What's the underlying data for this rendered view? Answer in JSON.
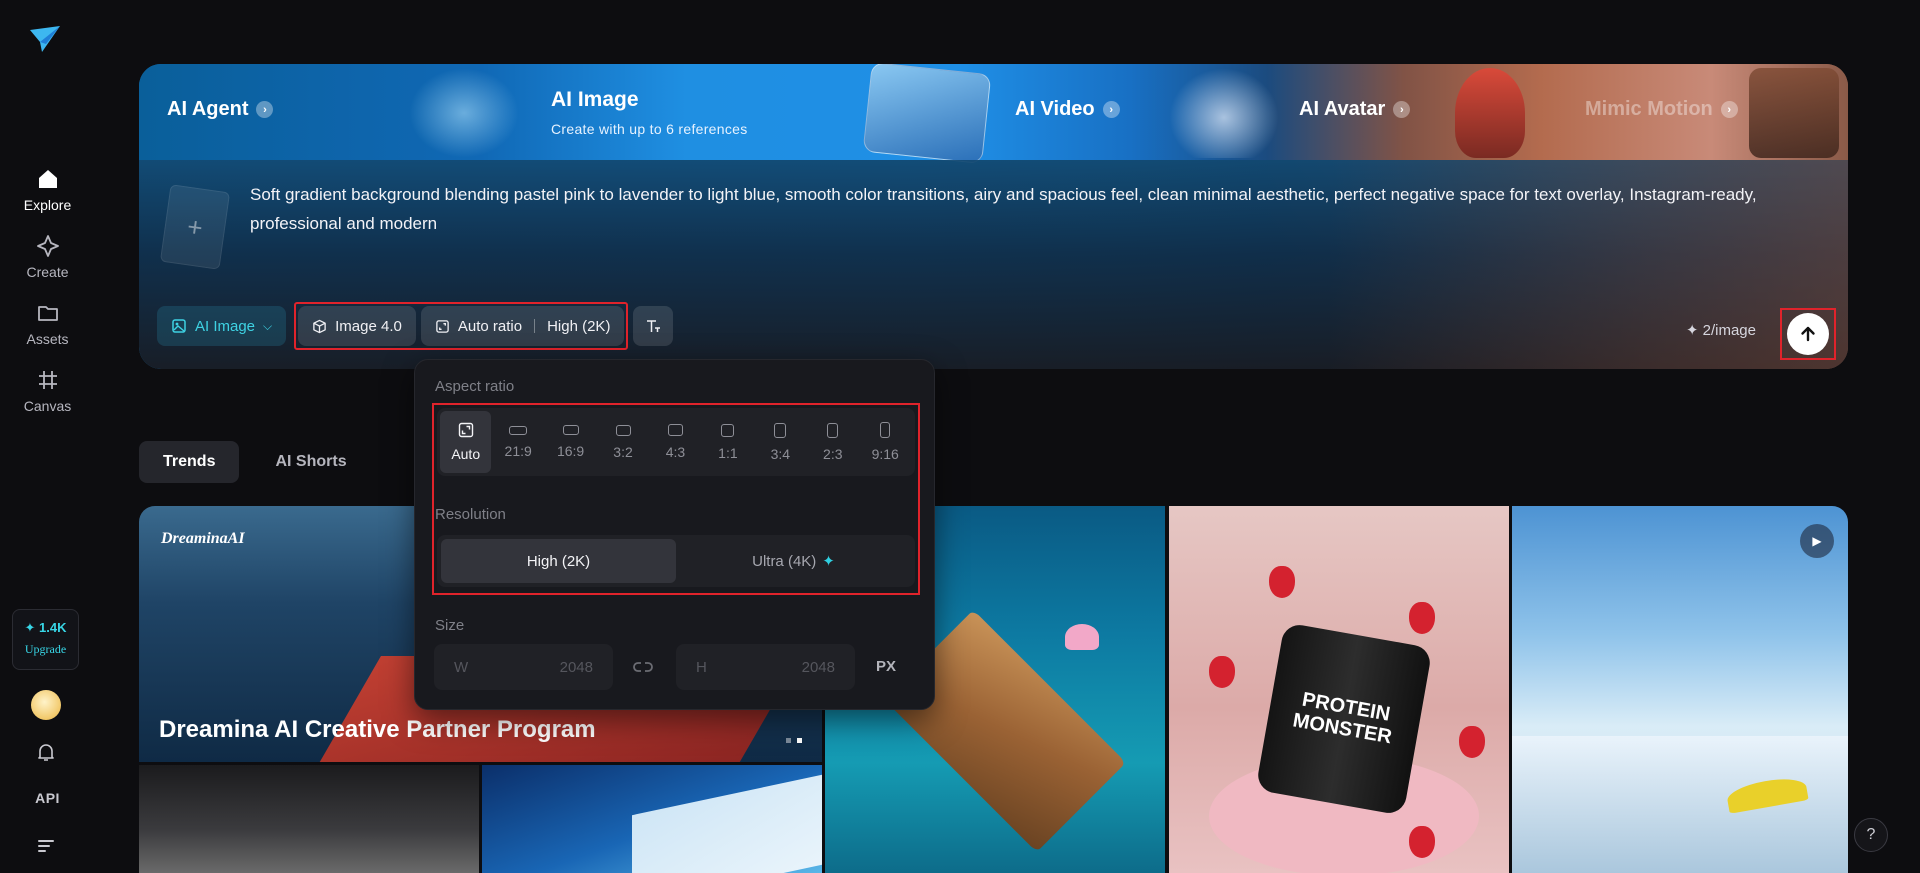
{
  "sidebar": {
    "items": [
      {
        "label": "Explore",
        "icon": "home-icon",
        "active": true
      },
      {
        "label": "Create",
        "icon": "sparkle-icon"
      },
      {
        "label": "Assets",
        "icon": "folder-icon"
      },
      {
        "label": "Canvas",
        "icon": "canvas-grid-icon"
      }
    ],
    "credits": "✦ 1.4K",
    "upgrade_label": "Upgrade",
    "api_label": "API"
  },
  "hero": {
    "tabs": [
      {
        "label": "AI Agent"
      },
      {
        "label": "AI Video"
      },
      {
        "label": "AI Avatar"
      },
      {
        "label": "Mimic Motion"
      }
    ],
    "active_tab": {
      "title": "AI Image",
      "subtitle": "Create with up to 6 references"
    },
    "prompt": "Soft gradient background blending pastel pink to lavender to light blue, smooth color transitions, airy and spacious feel, clean minimal aesthetic, perfect negative space for text overlay, Instagram-ready, professional and modern",
    "toolbar": {
      "mode": "AI Image",
      "model": "Image 4.0",
      "ratio": "Auto ratio",
      "resolution": "High (2K)"
    },
    "cost": "✦ 2/image"
  },
  "popover": {
    "aspect_label": "Aspect ratio",
    "ratios": [
      "Auto",
      "21:9",
      "16:9",
      "3:2",
      "4:3",
      "1:1",
      "3:4",
      "2:3",
      "9:16"
    ],
    "selected_ratio": "Auto",
    "resolution_label": "Resolution",
    "resolutions": [
      "High (2K)",
      "Ultra (4K)"
    ],
    "selected_resolution": "High (2K)",
    "size_label": "Size",
    "width_label": "W",
    "width_value": "2048",
    "height_label": "H",
    "height_value": "2048",
    "unit": "PX"
  },
  "feed": {
    "tabs": [
      "Trends",
      "AI Shorts"
    ],
    "active_tab": "Trends",
    "banner_brand": "DreaminaAI",
    "banner_title": "Dreamina AI Creative Partner Program",
    "product_text": "PROTEIN MONSTER"
  },
  "colors": {
    "accent": "#38d6e6",
    "highlight_box": "#e0232b",
    "background": "#0d0d10"
  }
}
